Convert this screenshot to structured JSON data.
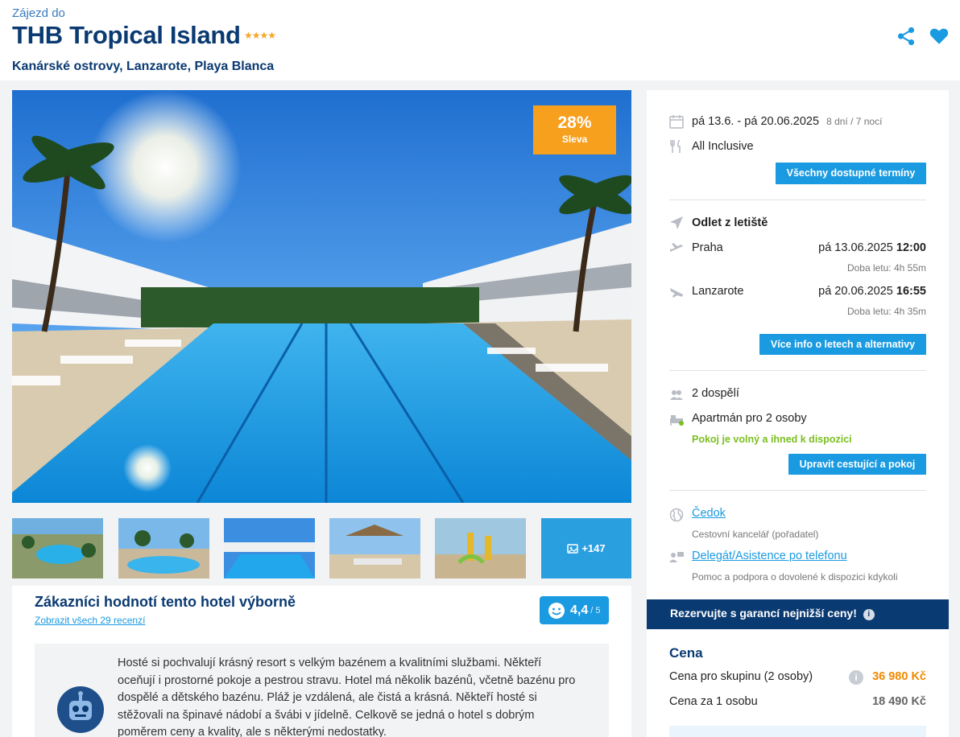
{
  "header": {
    "eyebrow": "Zájezd do",
    "title": "THB Tropical Island",
    "stars": "★★★★",
    "location": "Kanárské ostrovy, Lanzarote, Playa Blanca"
  },
  "gallery": {
    "badge_percent": "28%",
    "badge_label": "Sleva",
    "more_count": "+147"
  },
  "reviews": {
    "title": "Zákazníci hodnotí tento hotel výborně",
    "link": "Zobrazit všech 29 recenzí",
    "score": "4,4",
    "score_max": "/ 5",
    "summary": "Hosté si pochvalují krásný resort s velkým bazénem a kvalitními službami. Někteří oceňují i prostorné pokoje a pestrou stravu. Hotel má několik bazénů, včetně bazénu pro dospělé a dětského bazénu. Pláž je vzdálená, ale čistá a krásná. Někteří hosté si stěžovali na špinavé nádobí a švábi v jídelně. Celkově se jedná o hotel s dobrým poměrem ceny a kvality, ale s některými nedostatky."
  },
  "sidebar": {
    "dates": "pá 13.6. - pá 20.06.2025",
    "duration": "8 dní / 7 nocí",
    "board": "All Inclusive",
    "dates_button": "Všechny dostupné termíny",
    "flights_title": "Odlet z letiště",
    "outbound_city": "Praha",
    "outbound_date": "pá 13.06.2025",
    "outbound_time": "12:00",
    "outbound_duration": "Doba letu: 4h 55m",
    "return_city": "Lanzarote",
    "return_date": "pá 20.06.2025",
    "return_time": "16:55",
    "return_duration": "Doba letu: 4h 35m",
    "flights_button": "Více info o letech a alternativy",
    "travelers": "2 dospělí",
    "room": "Apartmán pro 2 osoby",
    "room_status": "Pokoj je volný a ihned k dispozici",
    "room_button": "Upravit cestující a pokoj",
    "operator_link": "Čedok",
    "operator_desc": "Cestovní kancelář (pořadatel)",
    "support_link": "Delegát/Asistence po telefonu",
    "support_desc": "Pomoc a podpora o dovolené k dispozici kdykoli",
    "guarantee": "Rezervujte s garancí nejnižší ceny!",
    "price_title": "Cena",
    "group_price_label": "Cena pro skupinu (2 osoby)",
    "group_price": "36 980 Kč",
    "person_price_label": "Cena za 1 osobu",
    "person_price": "18 490 Kč"
  }
}
